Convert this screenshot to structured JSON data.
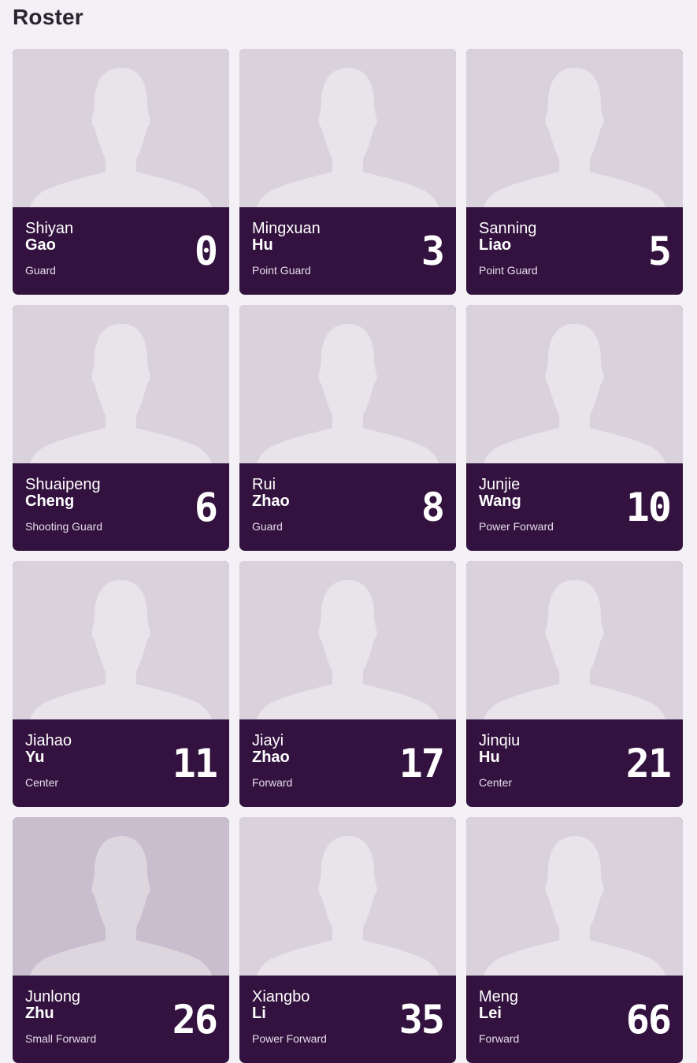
{
  "page": {
    "title": "Roster"
  },
  "players": [
    {
      "first": "Shiyan",
      "last": "Gao",
      "position": "Guard",
      "number": "0"
    },
    {
      "first": "Mingxuan",
      "last": "Hu",
      "position": "Point Guard",
      "number": "3"
    },
    {
      "first": "Sanning",
      "last": "Liao",
      "position": "Point Guard",
      "number": "5"
    },
    {
      "first": "Shuaipeng",
      "last": "Cheng",
      "position": "Shooting Guard",
      "number": "6"
    },
    {
      "first": "Rui",
      "last": "Zhao",
      "position": "Guard",
      "number": "8"
    },
    {
      "first": "Junjie",
      "last": "Wang",
      "position": "Power Forward",
      "number": "10"
    },
    {
      "first": "Jiahao",
      "last": "Yu",
      "position": "Center",
      "number": "11"
    },
    {
      "first": "Jiayi",
      "last": "Zhao",
      "position": "Forward",
      "number": "17"
    },
    {
      "first": "Jinqiu",
      "last": "Hu",
      "position": "Center",
      "number": "21"
    },
    {
      "first": "Junlong",
      "last": "Zhu",
      "position": "Small Forward",
      "number": "26"
    },
    {
      "first": "Xiangbo",
      "last": "Li",
      "position": "Power Forward",
      "number": "35"
    },
    {
      "first": "Meng",
      "last": "Lei",
      "position": "Forward",
      "number": "66"
    }
  ],
  "theme": {
    "card_background": "#33123f",
    "photo_placeholder": "#d9d2dd",
    "silhouette": "#e8e4ea",
    "page_background": "#f3f1f5"
  },
  "icons": {
    "photo_placeholder": "person-silhouette-icon"
  }
}
